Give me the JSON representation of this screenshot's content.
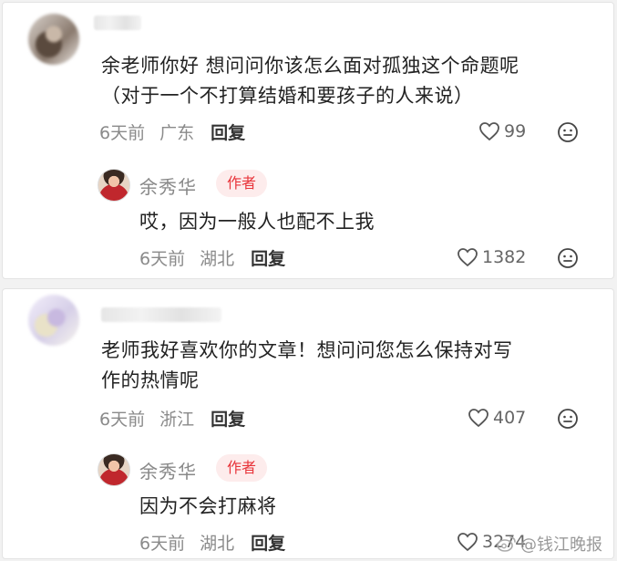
{
  "comments": [
    {
      "text_lines": [
        "余老师你好 想问问你该怎么面对孤独这个命题呢",
        "（对于一个不打算结婚和要孩子的人来说）"
      ],
      "time": "6天前",
      "location": "广东",
      "reply_label": "回复",
      "likes": "99",
      "author_reply": {
        "name": "余秀华",
        "badge": "作者",
        "text": "哎，因为一般人也配不上我",
        "time": "6天前",
        "location": "湖北",
        "reply_label": "回复",
        "likes": "1382"
      }
    },
    {
      "text_lines": [
        "老师我好喜欢你的文章！想问问您怎么保持对写",
        "作的热情呢"
      ],
      "time": "6天前",
      "location": "浙江",
      "reply_label": "回复",
      "likes": "407",
      "author_reply": {
        "name": "余秀华",
        "badge": "作者",
        "text": "因为不会打麻将",
        "time": "6天前",
        "location": "湖北",
        "reply_label": "回复",
        "likes": "3274"
      }
    }
  ],
  "watermark": "@钱江晚报",
  "colors": {
    "badge_text": "#e8343a",
    "badge_bg": "#fdecec",
    "meta": "#8a8a8a"
  },
  "icons": [
    "heart-icon",
    "emoji-icon",
    "weibo-icon"
  ]
}
